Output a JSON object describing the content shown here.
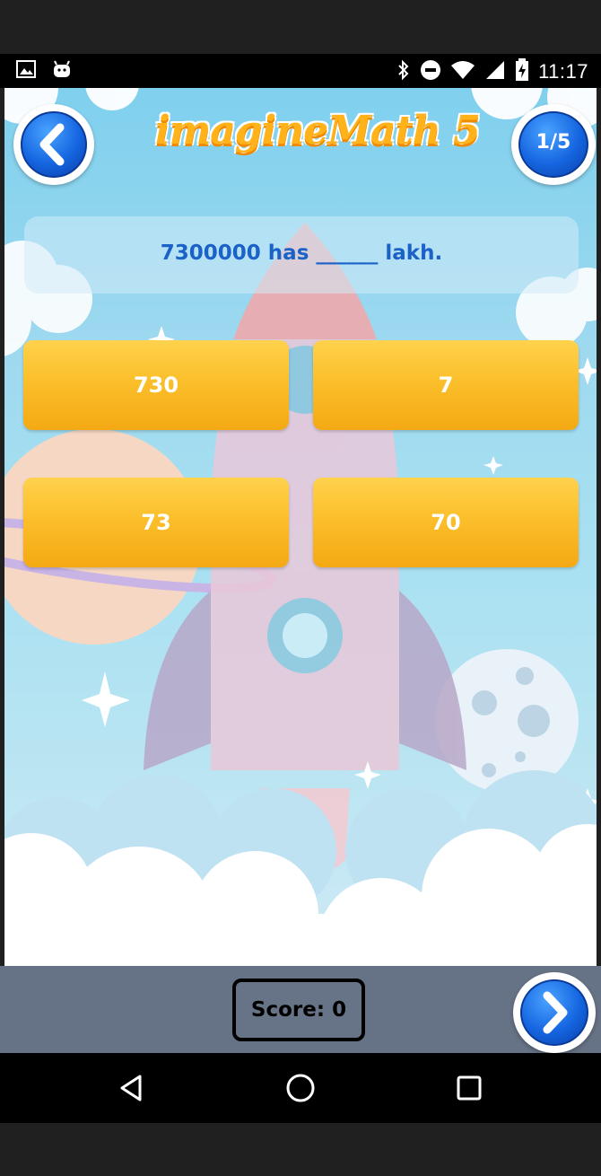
{
  "status_bar": {
    "time": "11:17",
    "left_icons": [
      "image-icon",
      "android-icon"
    ],
    "right_icons": [
      "bluetooth-icon",
      "do-not-disturb-icon",
      "wifi-icon",
      "signal-icon",
      "battery-charging-icon"
    ]
  },
  "header": {
    "app_title": "imagineMath 5",
    "question_counter": "1/5",
    "back_icon": "chevron-left-icon"
  },
  "question": {
    "text": "7300000 has ______ lakh."
  },
  "options": [
    {
      "label": "730"
    },
    {
      "label": "7"
    },
    {
      "label": "73"
    },
    {
      "label": "70"
    }
  ],
  "footer": {
    "score_text": "Score: 0",
    "next_icon": "chevron-right-icon"
  },
  "nav_bar": {
    "buttons": [
      "back-triangle-icon",
      "home-circle-icon",
      "recents-square-icon"
    ]
  },
  "colors": {
    "title": "#ffb21a",
    "question_text": "#1a62c8",
    "option_fill": "#fbbf2b",
    "button_blue": "#1565e0",
    "footer_bg": "#667285"
  }
}
